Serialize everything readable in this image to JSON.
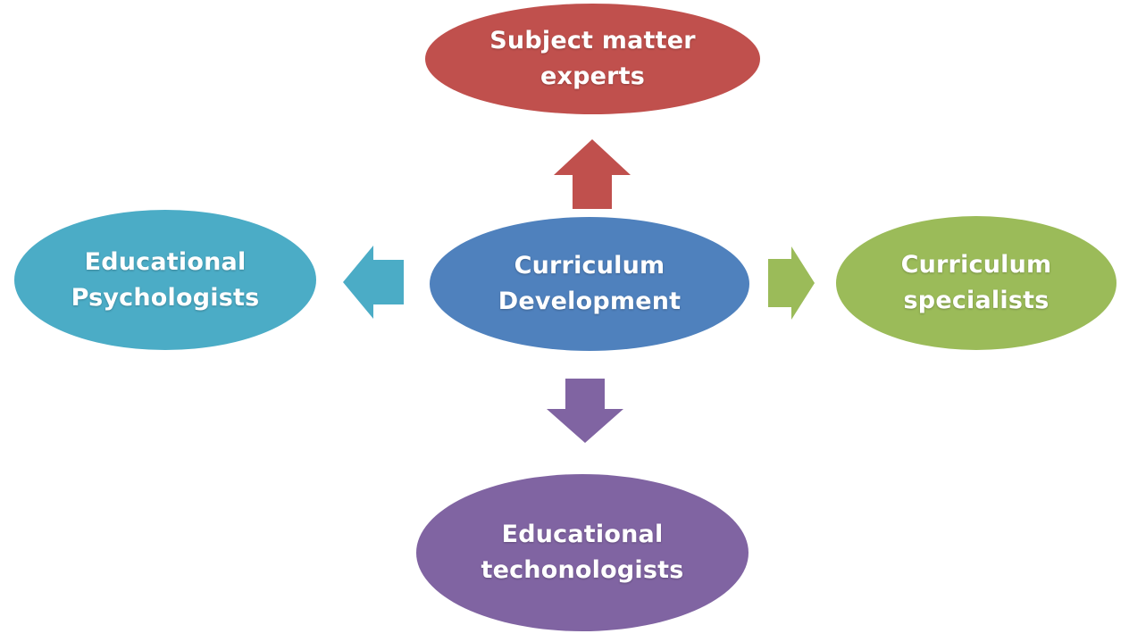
{
  "diagram": {
    "center": {
      "label": "Curriculum\nDevelopment",
      "color": "#4f81bd"
    },
    "nodes": {
      "top": {
        "label": "Subject matter\nexperts",
        "color": "#c0504d"
      },
      "left": {
        "label": "Educational\nPsychologists",
        "color": "#4bacc6"
      },
      "right": {
        "label": "Curriculum\nspecialists",
        "color": "#9bbb59"
      },
      "bottom": {
        "label": "Educational\ntechonologists",
        "color": "#8064a2"
      }
    }
  }
}
